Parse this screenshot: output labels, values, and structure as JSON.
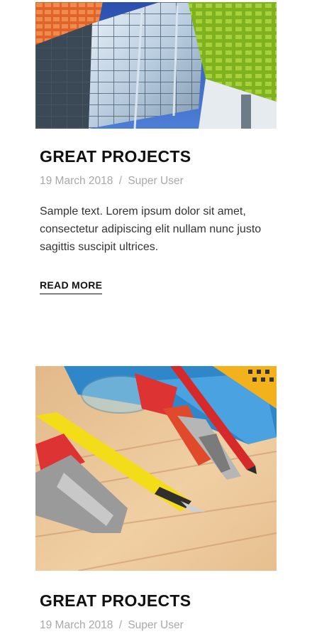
{
  "posts": [
    {
      "image_alt": "Modern glass building with colorful facade",
      "title": "GREAT PROJECTS",
      "date": "19 March 2018",
      "separator": "/",
      "author": "Super User",
      "excerpt": "Sample text. Lorem ipsum dolor sit amet, consectetur adipiscing elit nullam nunc justo sagittis suscipit ultrices.",
      "read_more": "READ MORE"
    },
    {
      "image_alt": "Tools: pliers, utility knife, pencil on wooden table",
      "title": "GREAT PROJECTS",
      "date": "19 March 2018",
      "separator": "/",
      "author": "Super User"
    }
  ],
  "colors": {
    "title": "#111111",
    "meta": "#a8a8a8",
    "text": "#333333"
  }
}
